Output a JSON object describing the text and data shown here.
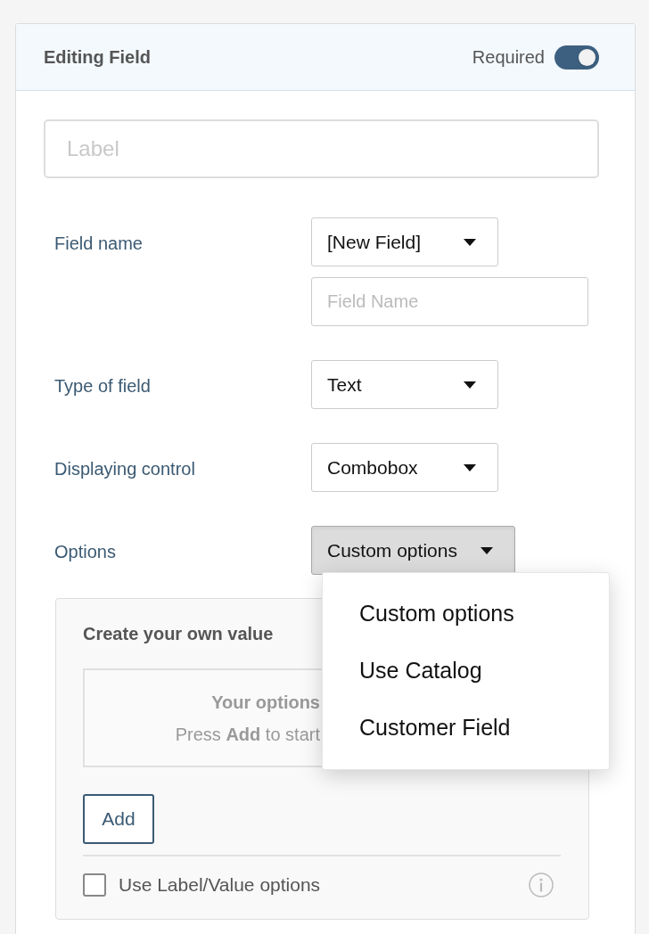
{
  "header": {
    "title": "Editing Field",
    "required_label": "Required",
    "required_on": true
  },
  "label_field": {
    "placeholder": "Label"
  },
  "rows": [
    {
      "label": "Field name",
      "select": "[New Field]",
      "open": false,
      "extra_field": {
        "placeholder": "Field Name"
      }
    },
    {
      "label": "Type of field",
      "select": "Text",
      "open": false
    },
    {
      "label": "Displaying control",
      "select": "Combobox",
      "open": false
    },
    {
      "label": "Options",
      "select": "Custom options",
      "open": true,
      "menu": [
        "Custom options",
        "Use Catalog",
        "Customer Field"
      ]
    }
  ],
  "options_panel": {
    "title": "Create your own value",
    "empty_title": "Your options",
    "empty_hint": "Press **Add** to start",
    "add_button": "Add",
    "checkbox": {
      "label": "Use Label/Value options",
      "checked": false
    }
  }
}
